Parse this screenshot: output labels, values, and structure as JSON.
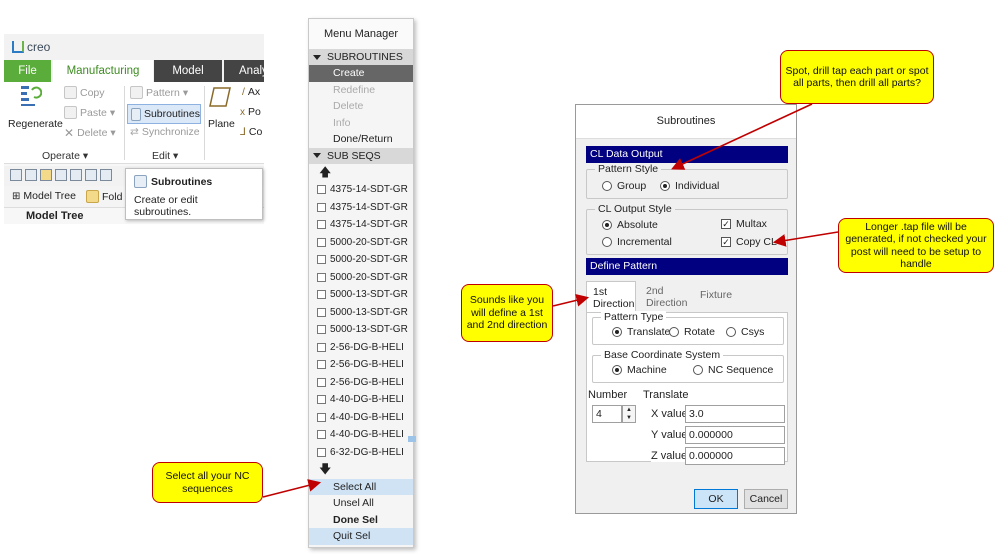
{
  "creo": {
    "app_name": "creo",
    "tabs": [
      "File",
      "Manufacturing",
      "Model",
      "Analy"
    ],
    "ribbon": {
      "regenerate": "Regenerate",
      "copy": "Copy",
      "paste": "Paste",
      "delete": "Delete",
      "operate_group": "Operate",
      "pattern": "Pattern",
      "subroutines": "Subroutines",
      "synchronize": "Synchronize",
      "edit_group": "Edit",
      "plane": "Plane",
      "axis_partial": "Ax",
      "point_partial": "Po",
      "csys_partial": "Co"
    },
    "tree_tabs": [
      "Model Tree",
      "Fold"
    ],
    "tree_header": "Model Tree",
    "tooltip": {
      "title": "Subroutines",
      "body": "Create or edit subroutines."
    }
  },
  "menu_manager": {
    "title": "Menu Manager",
    "section1": "SUBROUTINES",
    "items1": [
      {
        "label": "Create",
        "state": "active"
      },
      {
        "label": "Redefine",
        "state": "disabled"
      },
      {
        "label": "Delete",
        "state": "disabled"
      },
      {
        "label": "Info",
        "state": "disabled"
      },
      {
        "label": "Done/Return",
        "state": "normal"
      }
    ],
    "section2": "SUB SEQS",
    "sequences": [
      "4375-14-SDT-GR",
      "4375-14-SDT-GR",
      "4375-14-SDT-GR",
      "5000-20-SDT-GR",
      "5000-20-SDT-GR",
      "5000-20-SDT-GR",
      "5000-13-SDT-GR",
      "5000-13-SDT-GR",
      "5000-13-SDT-GR",
      "2-56-DG-B-HELI",
      "2-56-DG-B-HELI",
      "2-56-DG-B-HELI",
      "4-40-DG-B-HELI",
      "4-40-DG-B-HELI",
      "4-40-DG-B-HELI",
      "6-32-DG-B-HELI"
    ],
    "actions": [
      "Select All",
      "Unsel All",
      "Done Sel",
      "Quit Sel"
    ]
  },
  "dialog": {
    "title": "Subroutines",
    "cl_data_output": "CL Data Output",
    "pattern_style": {
      "label": "Pattern Style",
      "options": [
        "Group",
        "Individual"
      ],
      "selected": "Individual"
    },
    "cl_output_style": {
      "label": "CL Output Style",
      "options": [
        "Absolute",
        "Incremental"
      ],
      "selected": "Absolute"
    },
    "multax": {
      "label": "Multax",
      "checked": true
    },
    "copy_cl": {
      "label": "Copy CL",
      "checked": true
    },
    "define_pattern": "Define Pattern",
    "tabs": [
      "1st Direction",
      "2nd Direction",
      "Fixture"
    ],
    "pattern_type": {
      "label": "Pattern Type",
      "options": [
        "Translate",
        "Rotate",
        "Csys"
      ],
      "selected": "Translate"
    },
    "base_csys": {
      "label": "Base Coordinate System",
      "options": [
        "Machine",
        "NC Sequence"
      ],
      "selected": "Machine"
    },
    "number_label": "Number",
    "number_value": "4",
    "translate_label": "Translate",
    "x_label": "X value",
    "x_value": "3.0",
    "y_label": "Y value",
    "y_value": "0.000000",
    "z_label": "Z value",
    "z_value": "0.000000",
    "ok": "OK",
    "cancel": "Cancel"
  },
  "callouts": {
    "spot": "Spot, drill tap each part or spot all parts, then drill all parts?",
    "tap": "Longer .tap file will be generated, if not checked your post will need to be setup to handle",
    "direction": "Sounds like you will define a 1st and 2nd direction",
    "select_all": "Select all your NC sequences"
  },
  "colors": {
    "creo_green": "#5aad3a",
    "dialog_header": "#000080",
    "callout_fill": "#ffff00",
    "callout_border": "#c00000"
  }
}
